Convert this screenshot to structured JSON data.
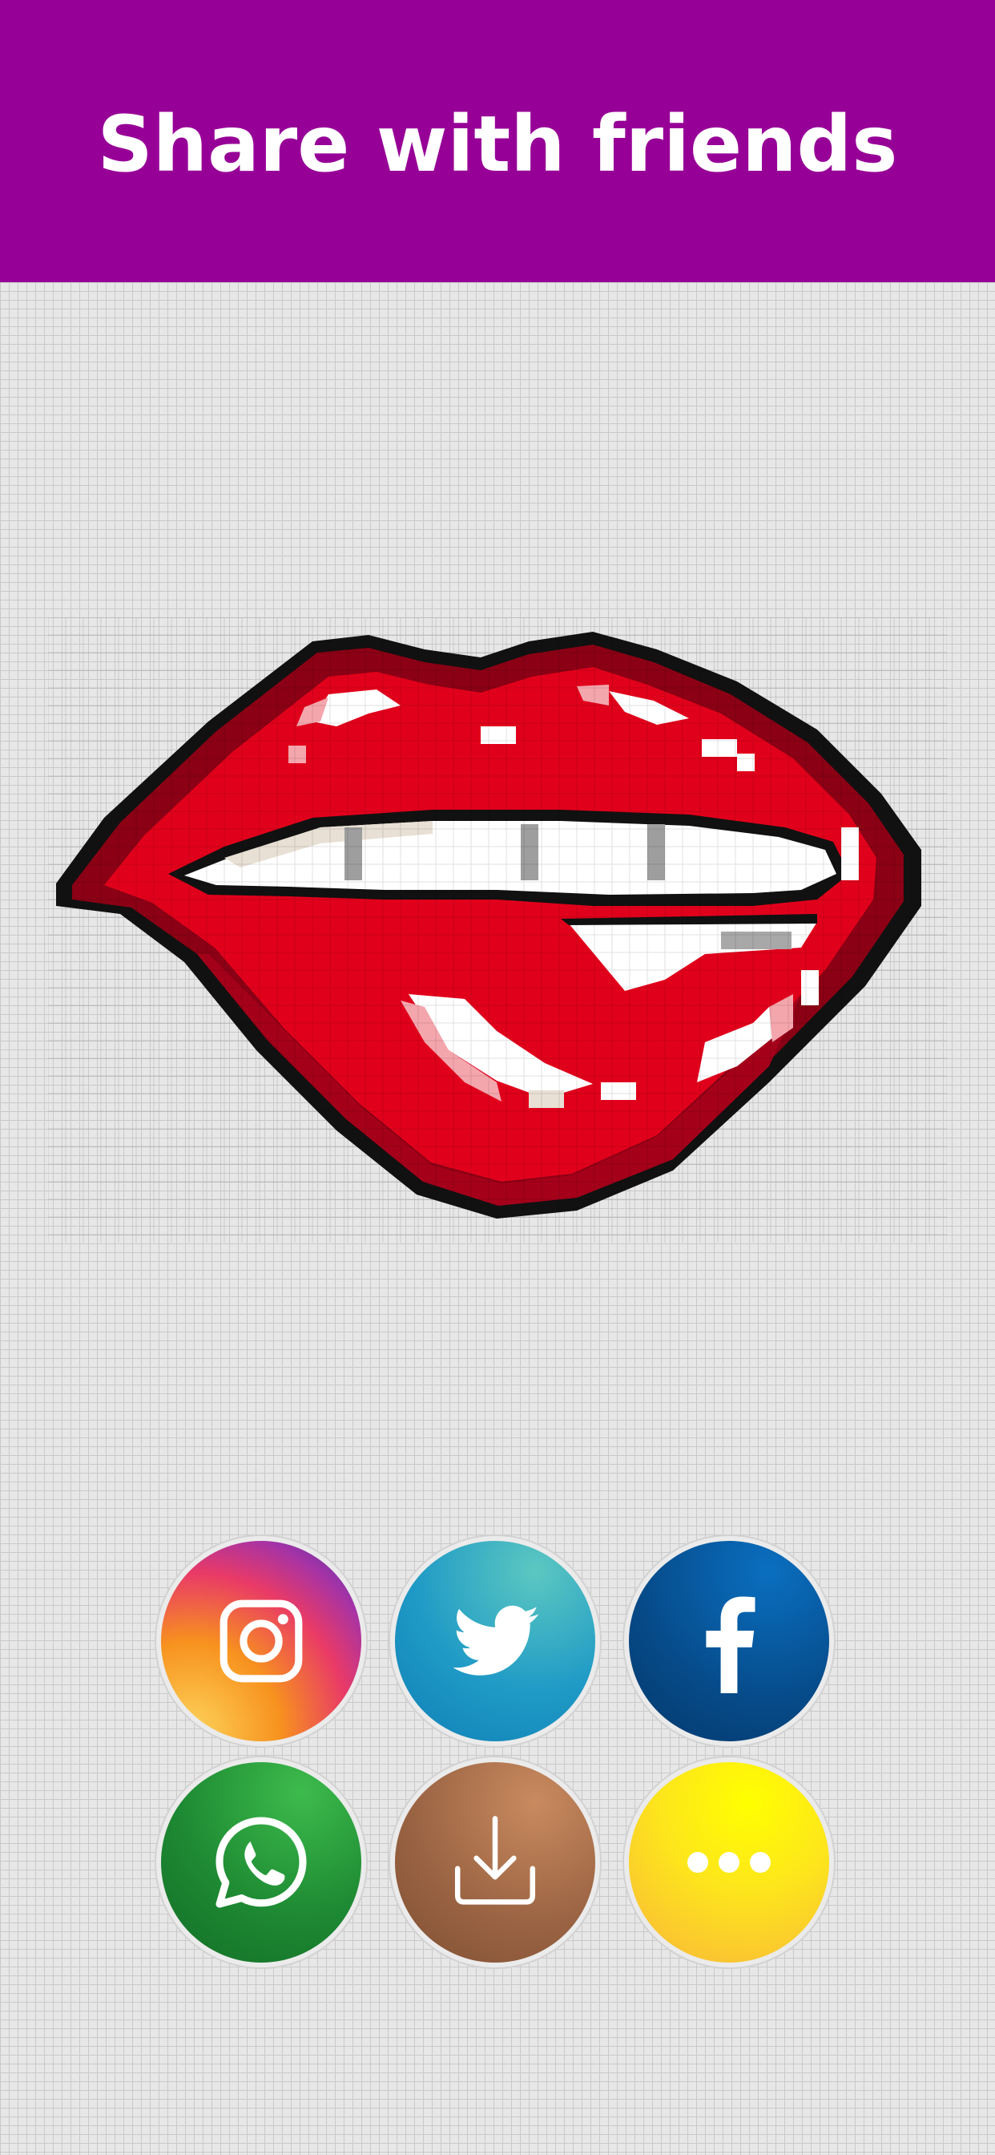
{
  "header": {
    "title": "Share with friends"
  },
  "share_buttons": [
    {
      "id": "instagram",
      "icon": "instagram-icon"
    },
    {
      "id": "twitter",
      "icon": "twitter-icon"
    },
    {
      "id": "facebook",
      "icon": "facebook-icon"
    },
    {
      "id": "whatsapp",
      "icon": "whatsapp-icon"
    },
    {
      "id": "download",
      "icon": "download-icon"
    },
    {
      "id": "more",
      "icon": "more-icon"
    }
  ],
  "artwork": {
    "subject": "pixel-art-lips"
  },
  "colors": {
    "header_bg": "#970097",
    "lip_red": "#e1001b",
    "lip_dark": "#8b0014",
    "outline": "#111111",
    "teeth": "#ffffff"
  }
}
